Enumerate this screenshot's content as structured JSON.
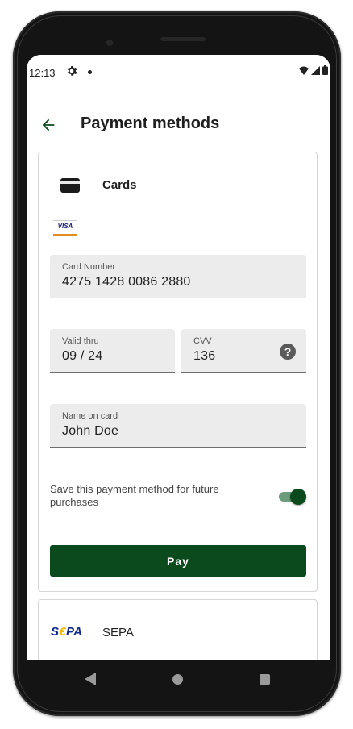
{
  "status_bar": {
    "time": "12:13",
    "icons": [
      "gear-icon",
      "notification-dot-icon",
      "wifi-icon",
      "signal-icon",
      "battery-icon"
    ]
  },
  "app_bar": {
    "back_icon": "arrow-back-icon",
    "title": "Payment methods"
  },
  "cards_section": {
    "icon": "credit-card-icon",
    "title": "Cards",
    "brand_logo": "VISA",
    "card_number": {
      "label": "Card Number",
      "value": "4275 1428 0086 2880"
    },
    "valid_thru": {
      "label": "Valid thru",
      "value": "09 / 24"
    },
    "cvv": {
      "label": "CVV",
      "value": "136",
      "help_icon": "?"
    },
    "name_on_card": {
      "label": "Name on card",
      "value": "John Doe"
    },
    "save_option": {
      "label": "Save this payment method for future purchases",
      "enabled": true
    },
    "pay_button": "Pay"
  },
  "sepa_section": {
    "logo_prefix": "S",
    "logo_euro": "€",
    "logo_suffix": "PA",
    "title": "SEPA"
  },
  "nav_bar": {
    "icons": [
      "nav-back-icon",
      "nav-home-icon",
      "nav-recents-icon"
    ]
  },
  "colors": {
    "primary": "#0b4a1c",
    "toggle_track": "#6d9c7b",
    "field_background": "#ececec",
    "back_arrow": "#0b4a1c"
  }
}
